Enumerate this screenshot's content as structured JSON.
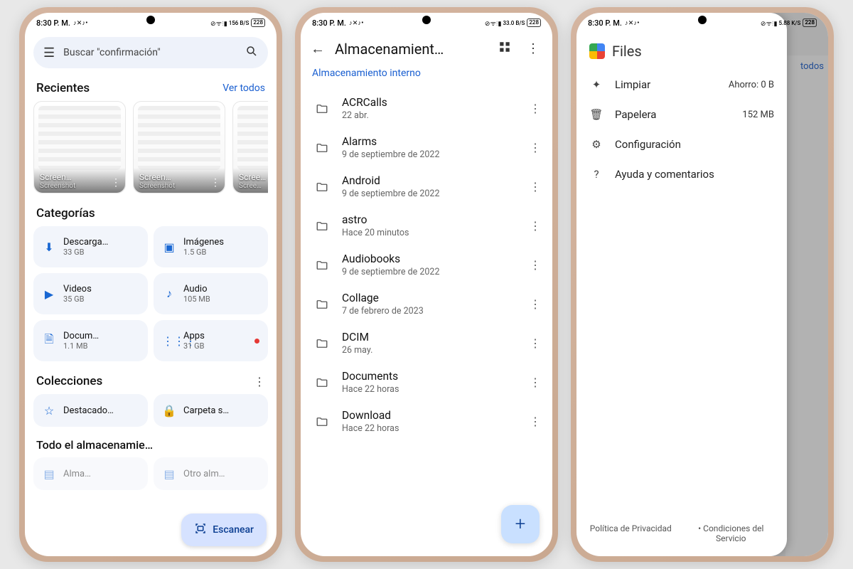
{
  "status": {
    "time": "8:30 P. M.",
    "net_label": "156 B/S",
    "net_label3": "5.88 K/S",
    "net_label2": "33.0 B/S",
    "batt": "228"
  },
  "p1": {
    "search_placeholder": "Buscar \"confirmación\"",
    "recents_title": "Recientes",
    "recents_link": "Ver todos",
    "thumbs": [
      {
        "title": "Screen…",
        "sub": "Screenshot"
      },
      {
        "title": "Screen…",
        "sub": "Screenshot"
      },
      {
        "title": "Scree…",
        "sub": "Scree…"
      }
    ],
    "categories_title": "Categorías",
    "categories": [
      {
        "name": "Descarga…",
        "size": "33 GB",
        "icon": "download"
      },
      {
        "name": "Imágenes",
        "size": "1.5 GB",
        "icon": "image"
      },
      {
        "name": "Videos",
        "size": "35 GB",
        "icon": "video"
      },
      {
        "name": "Audio",
        "size": "105 MB",
        "icon": "audio"
      },
      {
        "name": "Docum…",
        "size": "1.1 MB",
        "icon": "doc"
      },
      {
        "name": "Apps",
        "size": "31 GB",
        "icon": "apps",
        "badge": true
      }
    ],
    "collections_title": "Colecciones",
    "collections": [
      {
        "name": "Destacado…",
        "icon": "star"
      },
      {
        "name": "Carpeta s…",
        "icon": "lock"
      }
    ],
    "all_storage_title": "Todo el almacenamie…",
    "storage_items": [
      "Alma…",
      "Otro alm…"
    ],
    "scan_label": "Escanear"
  },
  "p2": {
    "title": "Almacenamient…",
    "subtitle": "Almacenamiento interno",
    "folders": [
      {
        "name": "ACRCalls",
        "date": "22 abr."
      },
      {
        "name": "Alarms",
        "date": "9 de septiembre de 2022"
      },
      {
        "name": "Android",
        "date": "9 de septiembre de 2022"
      },
      {
        "name": "astro",
        "date": "Hace 20 minutos"
      },
      {
        "name": "Audiobooks",
        "date": "9 de septiembre de 2022"
      },
      {
        "name": "Collage",
        "date": "7 de febrero de 2023"
      },
      {
        "name": "DCIM",
        "date": "26 may."
      },
      {
        "name": "Documents",
        "date": "Hace 22 horas"
      },
      {
        "name": "Download",
        "date": "Hace 22 horas"
      }
    ]
  },
  "p3": {
    "app_title": "Files",
    "items": [
      {
        "label": "Limpiar",
        "right": "Ahorro: 0 B",
        "icon": "sparkle"
      },
      {
        "label": "Papelera",
        "right": "152 MB",
        "icon": "trash"
      },
      {
        "label": "Configuración",
        "icon": "gear"
      },
      {
        "label": "Ayuda y comentarios",
        "icon": "help"
      }
    ],
    "footer": {
      "privacy": "Política de Privacidad",
      "terms": "Condiciones del Servicio"
    },
    "bg_link": "todos"
  }
}
